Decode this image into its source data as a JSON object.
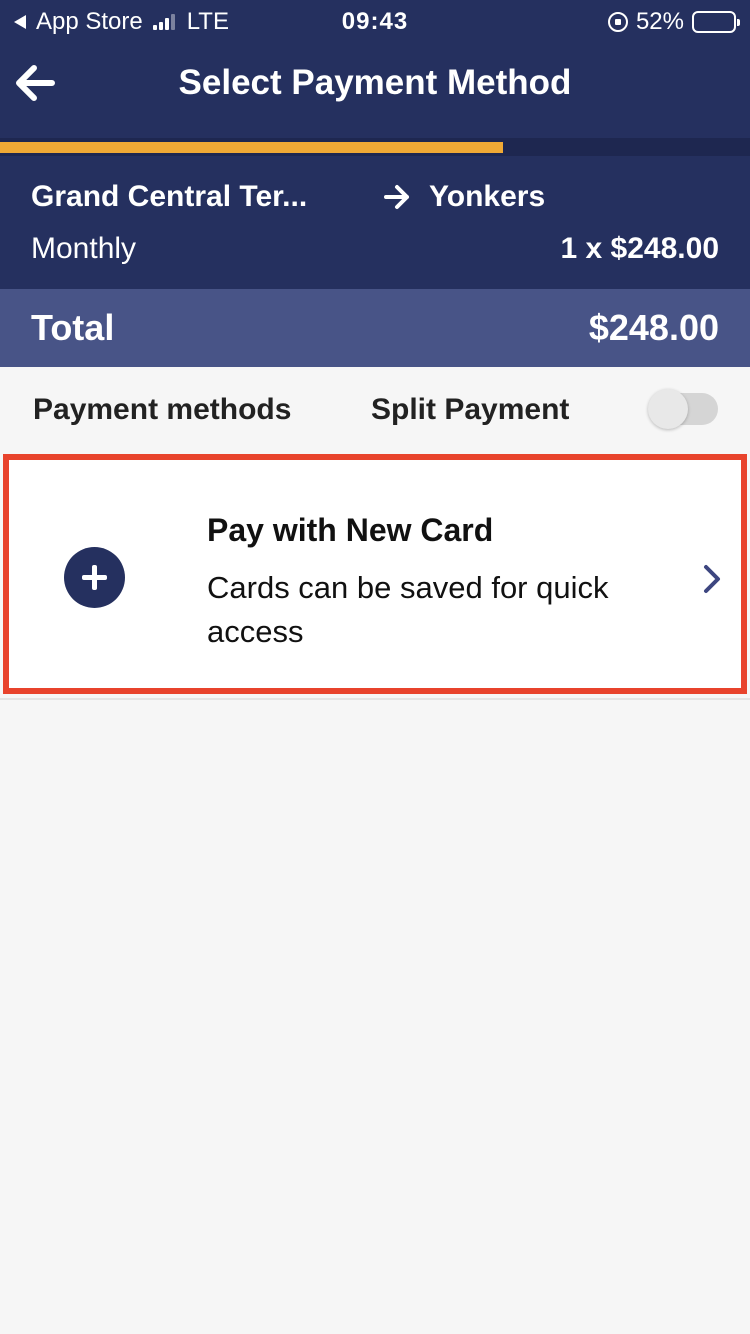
{
  "status_bar": {
    "back_app": "App Store",
    "network": "LTE",
    "time": "09:43",
    "battery_percent": "52%",
    "battery_level": 0.52
  },
  "nav": {
    "title": "Select Payment Method",
    "back_icon": "arrow-left-icon"
  },
  "progress": {
    "fraction": 0.67,
    "color": "#f0a935"
  },
  "trip": {
    "from": "Grand Central Ter...",
    "to": "Yonkers",
    "period": "Monthly",
    "price": "1 x $248.00"
  },
  "total": {
    "label": "Total",
    "amount": "$248.00"
  },
  "payment": {
    "methods_label": "Payment methods",
    "split_label": "Split Payment",
    "split_enabled": false
  },
  "new_card": {
    "title": "Pay with New Card",
    "subtitle": "Cards can be saved for quick access",
    "icon": "plus-circle-icon",
    "highlight_color": "#e8432c"
  },
  "colors": {
    "header": "#25305f",
    "total_bar": "#485487",
    "accent": "#f0a935",
    "background": "#f6f6f6"
  }
}
